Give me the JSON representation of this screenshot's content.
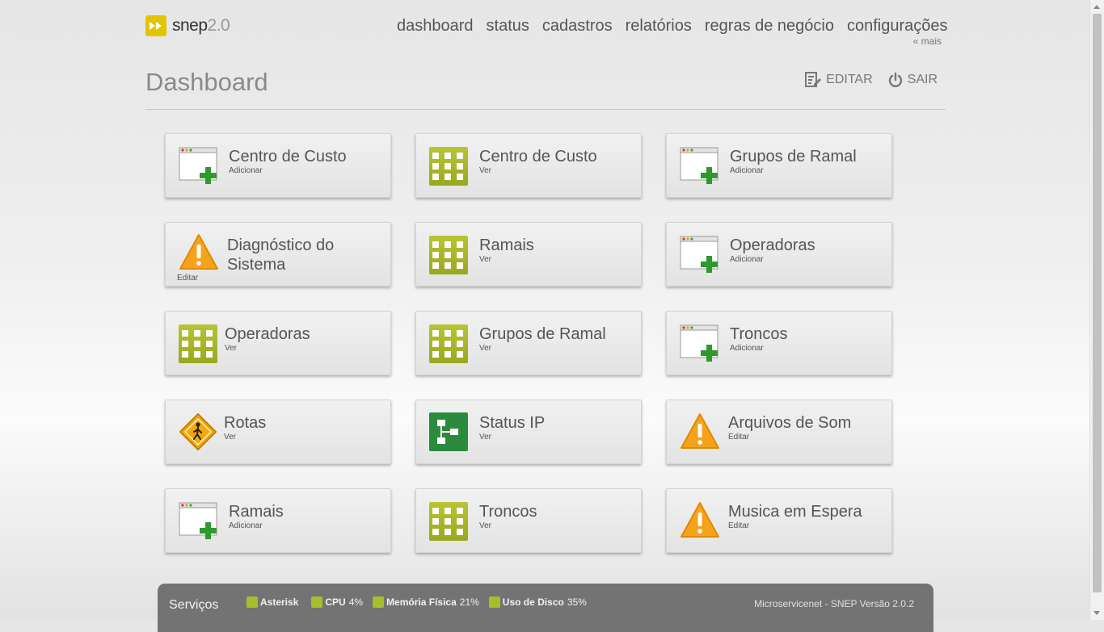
{
  "logo": {
    "text": "snep",
    "version": "2.0"
  },
  "nav": [
    {
      "label": "dashboard"
    },
    {
      "label": "status"
    },
    {
      "label": "cadastros"
    },
    {
      "label": "relatórios"
    },
    {
      "label": "regras de negócio"
    },
    {
      "label": "configurações"
    }
  ],
  "more": "« mais",
  "page_title": "Dashboard",
  "actions": {
    "edit": "EDITAR",
    "logout": "SAIR"
  },
  "tiles": [
    {
      "title": "Centro de Custo",
      "sub": "Adicionar",
      "icon": "add-window-icon"
    },
    {
      "title": "Centro de Custo",
      "sub": "Ver",
      "icon": "grid-icon"
    },
    {
      "title": "Grupos de Ramal",
      "sub": "Adicionar",
      "icon": "add-window-icon"
    },
    {
      "title": "Diagnóstico do Sistema",
      "sub": "Editar",
      "icon": "warning-icon"
    },
    {
      "title": "Ramais",
      "sub": "Ver",
      "icon": "grid-icon"
    },
    {
      "title": "Operadoras",
      "sub": "Adicionar",
      "icon": "add-window-icon"
    },
    {
      "title": "Operadoras",
      "sub": "Ver",
      "icon": "grid-icon"
    },
    {
      "title": "Grupos de Ramal",
      "sub": "Ver",
      "icon": "grid-icon"
    },
    {
      "title": "Troncos",
      "sub": "Adicionar",
      "icon": "add-window-icon"
    },
    {
      "title": "Rotas",
      "sub": "Ver",
      "icon": "route-sign-icon"
    },
    {
      "title": "Status IP",
      "sub": "Ver",
      "icon": "network-icon"
    },
    {
      "title": "Arquivos de Som",
      "sub": "Editar",
      "icon": "warning-icon"
    },
    {
      "title": "Ramais",
      "sub": "Adicionar",
      "icon": "add-window-icon"
    },
    {
      "title": "Troncos",
      "sub": "Ver",
      "icon": "grid-icon"
    },
    {
      "title": "Musica em Espera",
      "sub": "Editar",
      "icon": "warning-icon"
    }
  ],
  "footer": {
    "label": "Serviços",
    "services": [
      {
        "name": "Asterisk",
        "value": ""
      },
      {
        "name": "CPU",
        "value": "4%"
      },
      {
        "name": "Memória Física",
        "value": "21%"
      },
      {
        "name": "Uso de Disco",
        "value": "35%"
      }
    ],
    "version": "Microservicenet - SNEP Versão 2.0.2"
  },
  "colors": {
    "accent_green": "#a7bd2c",
    "logo_yellow": "#e3c400",
    "footer_bg": "#737373"
  }
}
